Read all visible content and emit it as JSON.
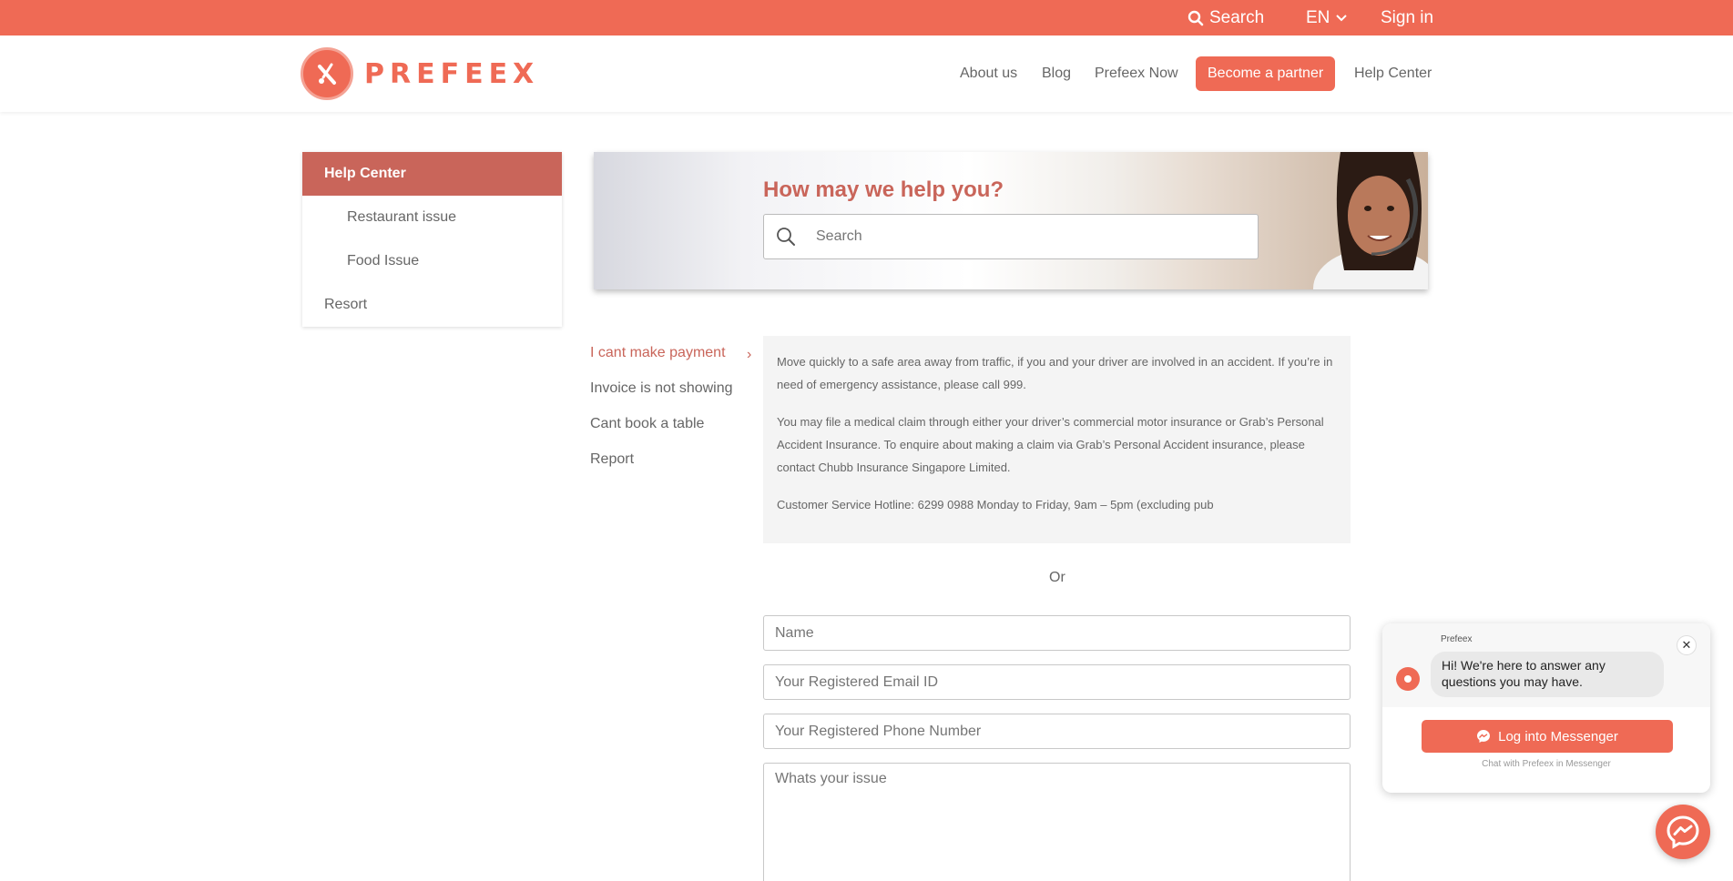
{
  "topbar": {
    "search_label": "Search",
    "language": "EN",
    "signin_label": "Sign in"
  },
  "header": {
    "logo_text": "PREFEEX",
    "nav": {
      "about": "About us",
      "blog": "Blog",
      "now": "Prefeex Now",
      "partner": "Become a partner",
      "help": "Help Center"
    }
  },
  "sidebar": {
    "items": [
      {
        "label": "Help Center"
      },
      {
        "label": "Restaurant issue"
      },
      {
        "label": "Food Issue"
      },
      {
        "label": "Resort"
      }
    ]
  },
  "hero": {
    "title": "How may we help you?",
    "search_placeholder": "Search"
  },
  "topics": [
    {
      "label": "I cant make payment"
    },
    {
      "label": "Invoice is not showing"
    },
    {
      "label": "Cant book a table"
    },
    {
      "label": "Report"
    }
  ],
  "article": {
    "p1": "Move quickly to a safe area away from traffic, if you and your driver are involved in an accident. If you’re in need of emergency assistance, please call 999.",
    "p2": "You may file a medical claim through either your driver’s commercial motor insurance or Grab’s Personal Accident Insurance. To enquire about making a claim via Grab’s Personal Accident insurance, please contact Chubb Insurance Singapore Limited.",
    "p3": "Customer Service Hotline: 6299 0988 Monday to Friday, 9am – 5pm (excluding pub"
  },
  "or_label": "Or",
  "form": {
    "name_placeholder": "Name",
    "email_placeholder": "Your Registered Email ID",
    "phone_placeholder": "Your Registered Phone Number",
    "issue_placeholder": "Whats your issue"
  },
  "chat": {
    "page_name": "Prefeex",
    "greeting": "Hi! We're here to answer any questions you may have.",
    "button_label": "Log into Messenger",
    "footer": "Chat with Prefeex in Messenger"
  },
  "colors": {
    "brand": "#ef6a55",
    "accent_dark": "#c9655a"
  }
}
